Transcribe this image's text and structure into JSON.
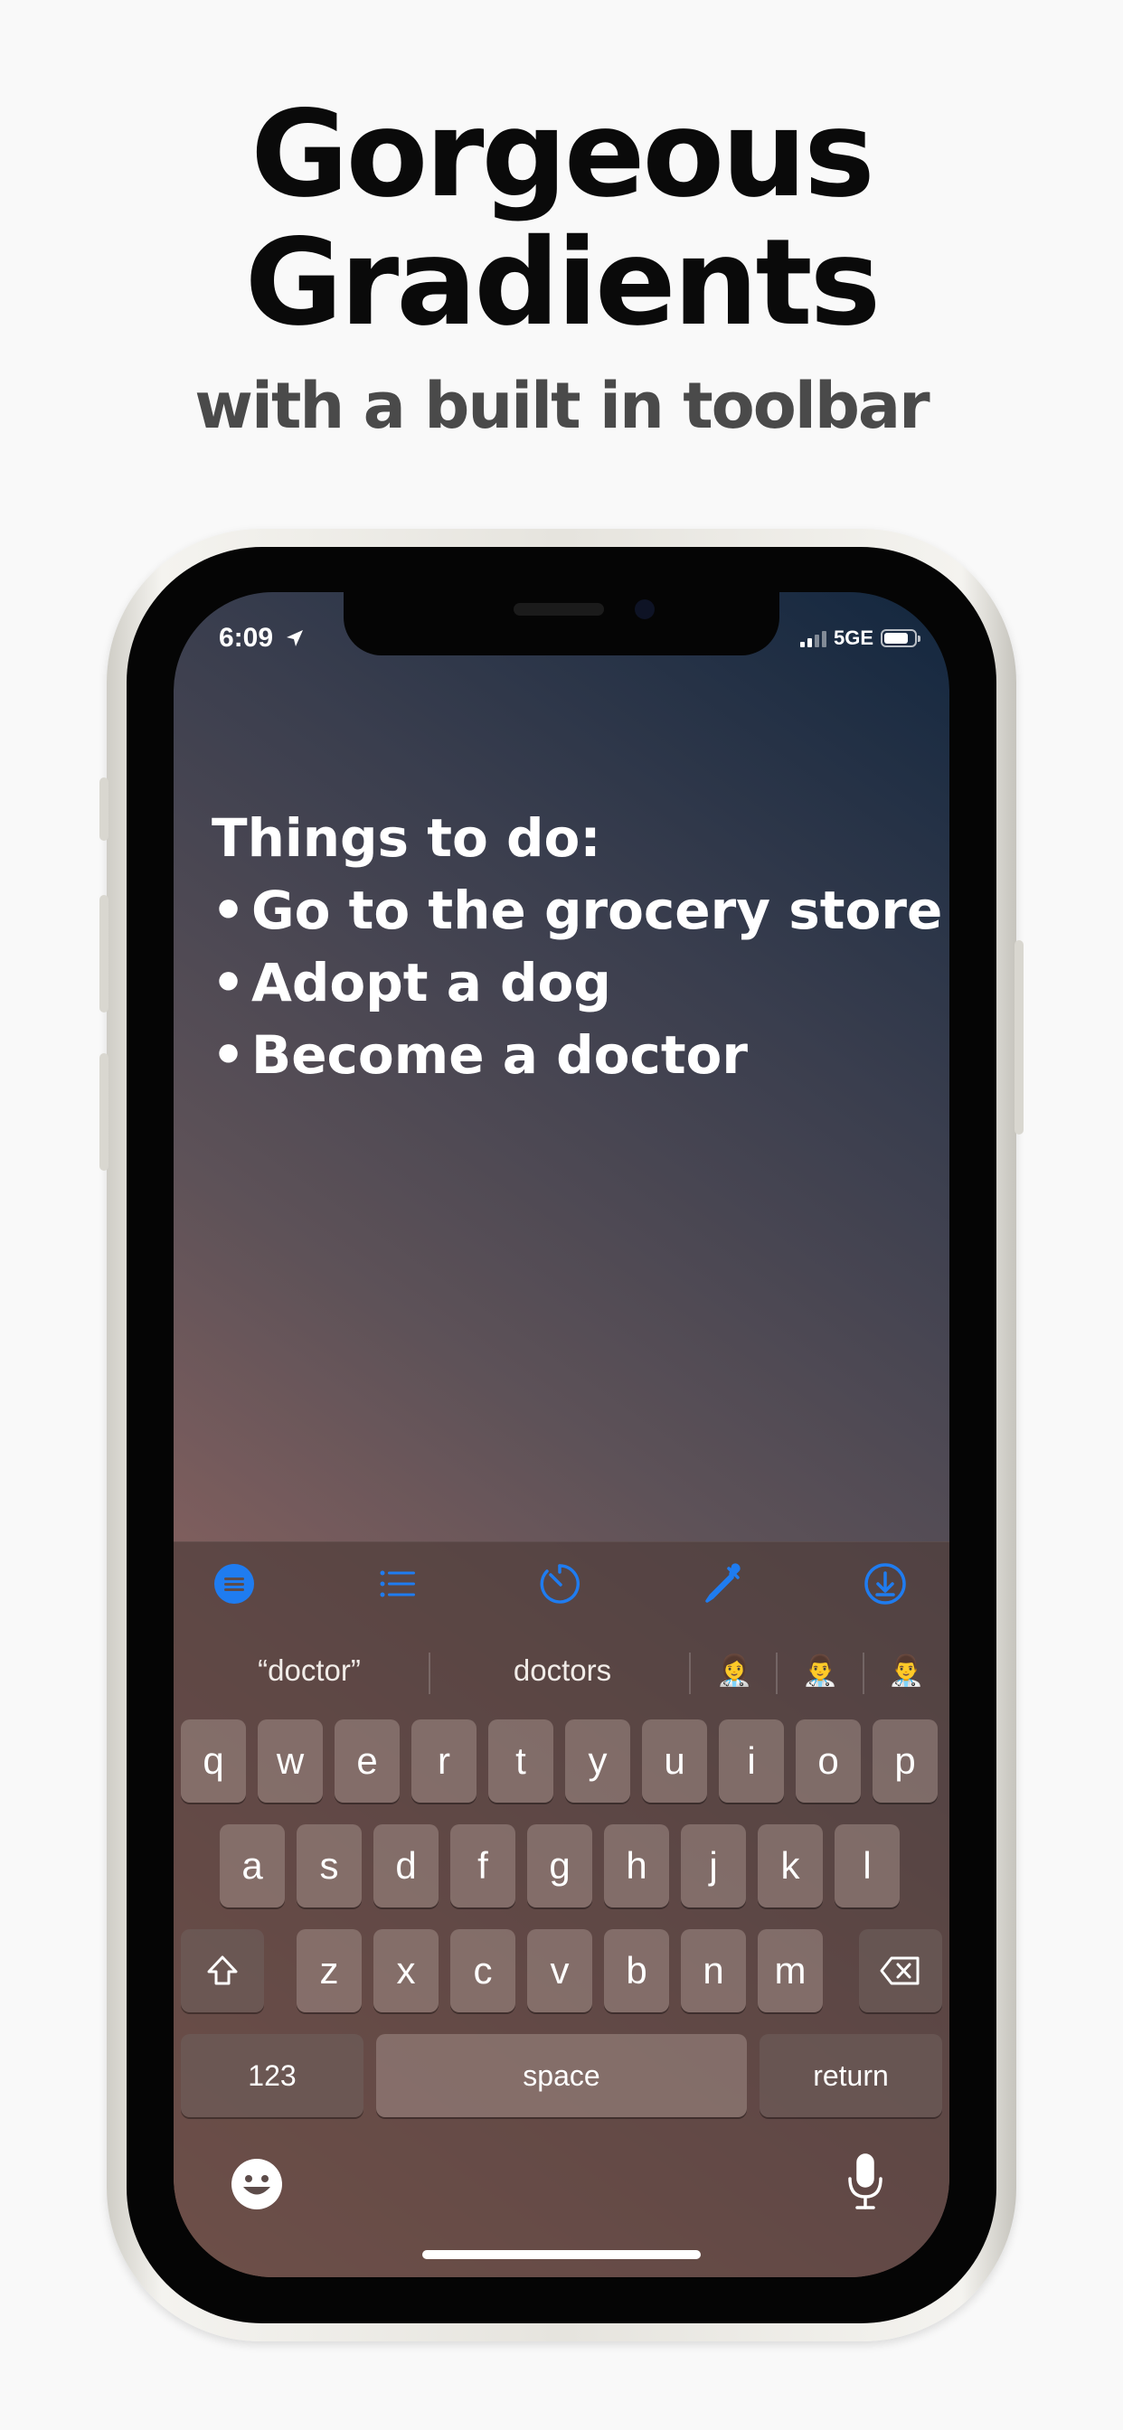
{
  "headline": {
    "line1": "Gorgeous",
    "line2": "Gradients"
  },
  "subheadline": "with a built in toolbar",
  "status_bar": {
    "time": "6:09",
    "network": "5GE",
    "location_icon": "location-arrow-icon"
  },
  "note": {
    "heading": "Things to do:",
    "items": [
      "Go to the grocery store",
      "Adopt a dog",
      "Become a doctor"
    ],
    "bullet": "•"
  },
  "toolbar": {
    "icons": [
      "text-style-icon",
      "list-icon",
      "timer-icon",
      "eyedropper-icon",
      "download-icon"
    ],
    "accent_color": "#1f7cf0"
  },
  "suggestions": [
    "“doctor”",
    "doctors",
    "👩‍⚕️",
    "👨‍⚕️",
    "👨‍⚕️"
  ],
  "keyboard": {
    "row1": [
      "q",
      "w",
      "e",
      "r",
      "t",
      "y",
      "u",
      "i",
      "o",
      "p"
    ],
    "row2": [
      "a",
      "s",
      "d",
      "f",
      "g",
      "h",
      "j",
      "k",
      "l"
    ],
    "row3": [
      "z",
      "x",
      "c",
      "v",
      "b",
      "n",
      "m"
    ],
    "numbers_label": "123",
    "space_label": "space",
    "return_label": "return"
  },
  "gradient_colors": [
    "#b77b6b",
    "#5e5258",
    "#13273f"
  ]
}
